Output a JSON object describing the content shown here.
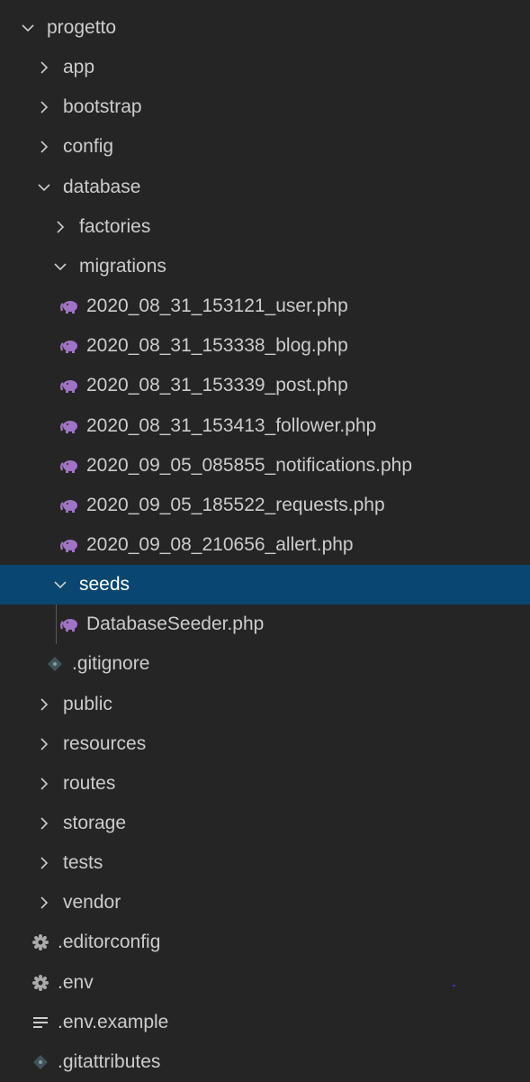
{
  "explorer": {
    "colors": {
      "background": "#252526",
      "selected": "#094771",
      "text": "#cccccc",
      "php_icon": "#a074c4",
      "git_icon": "#41535b"
    },
    "rows": [
      {
        "label": "progetto",
        "type": "folder",
        "expanded": true,
        "depth": 0,
        "icon": "chevron-down-icon"
      },
      {
        "label": "app",
        "type": "folder",
        "expanded": false,
        "depth": 1,
        "icon": "chevron-right-icon"
      },
      {
        "label": "bootstrap",
        "type": "folder",
        "expanded": false,
        "depth": 1,
        "icon": "chevron-right-icon"
      },
      {
        "label": "config",
        "type": "folder",
        "expanded": false,
        "depth": 1,
        "icon": "chevron-right-icon"
      },
      {
        "label": "database",
        "type": "folder",
        "expanded": true,
        "depth": 1,
        "icon": "chevron-down-icon"
      },
      {
        "label": "factories",
        "type": "folder",
        "expanded": false,
        "depth": 2,
        "icon": "chevron-right-icon"
      },
      {
        "label": "migrations",
        "type": "folder",
        "expanded": true,
        "depth": 2,
        "icon": "chevron-down-icon"
      },
      {
        "label": "2020_08_31_153121_user.php",
        "type": "php",
        "depth": 3,
        "icon": "php-elephant-icon"
      },
      {
        "label": "2020_08_31_153338_blog.php",
        "type": "php",
        "depth": 3,
        "icon": "php-elephant-icon"
      },
      {
        "label": "2020_08_31_153339_post.php",
        "type": "php",
        "depth": 3,
        "icon": "php-elephant-icon"
      },
      {
        "label": "2020_08_31_153413_follower.php",
        "type": "php",
        "depth": 3,
        "icon": "php-elephant-icon"
      },
      {
        "label": "2020_09_05_085855_notifications.php",
        "type": "php",
        "depth": 3,
        "icon": "php-elephant-icon"
      },
      {
        "label": "2020_09_05_185522_requests.php",
        "type": "php",
        "depth": 3,
        "icon": "php-elephant-icon"
      },
      {
        "label": "2020_09_08_210656_allert.php",
        "type": "php",
        "depth": 3,
        "icon": "php-elephant-icon"
      },
      {
        "label": "seeds",
        "type": "folder",
        "expanded": true,
        "depth": 2,
        "icon": "chevron-down-icon",
        "selected": true
      },
      {
        "label": "DatabaseSeeder.php",
        "type": "php",
        "depth": 3,
        "icon": "php-elephant-icon"
      },
      {
        "label": ".gitignore",
        "type": "git",
        "depth": 2,
        "icon": "git-diamond-icon"
      },
      {
        "label": "public",
        "type": "folder",
        "expanded": false,
        "depth": 1,
        "icon": "chevron-right-icon"
      },
      {
        "label": "resources",
        "type": "folder",
        "expanded": false,
        "depth": 1,
        "icon": "chevron-right-icon"
      },
      {
        "label": "routes",
        "type": "folder",
        "expanded": false,
        "depth": 1,
        "icon": "chevron-right-icon"
      },
      {
        "label": "storage",
        "type": "folder",
        "expanded": false,
        "depth": 1,
        "icon": "chevron-right-icon"
      },
      {
        "label": "tests",
        "type": "folder",
        "expanded": false,
        "depth": 1,
        "icon": "chevron-right-icon"
      },
      {
        "label": "vendor",
        "type": "folder",
        "expanded": false,
        "depth": 1,
        "icon": "chevron-right-icon"
      },
      {
        "label": ".editorconfig",
        "type": "gear",
        "depth": 1,
        "icon": "gear-icon"
      },
      {
        "label": ".env",
        "type": "gear",
        "depth": 1,
        "icon": "gear-icon"
      },
      {
        "label": ".env.example",
        "type": "lines",
        "depth": 1,
        "icon": "text-lines-icon"
      },
      {
        "label": ".gitattributes",
        "type": "git",
        "depth": 1,
        "icon": "git-diamond-icon"
      }
    ]
  }
}
